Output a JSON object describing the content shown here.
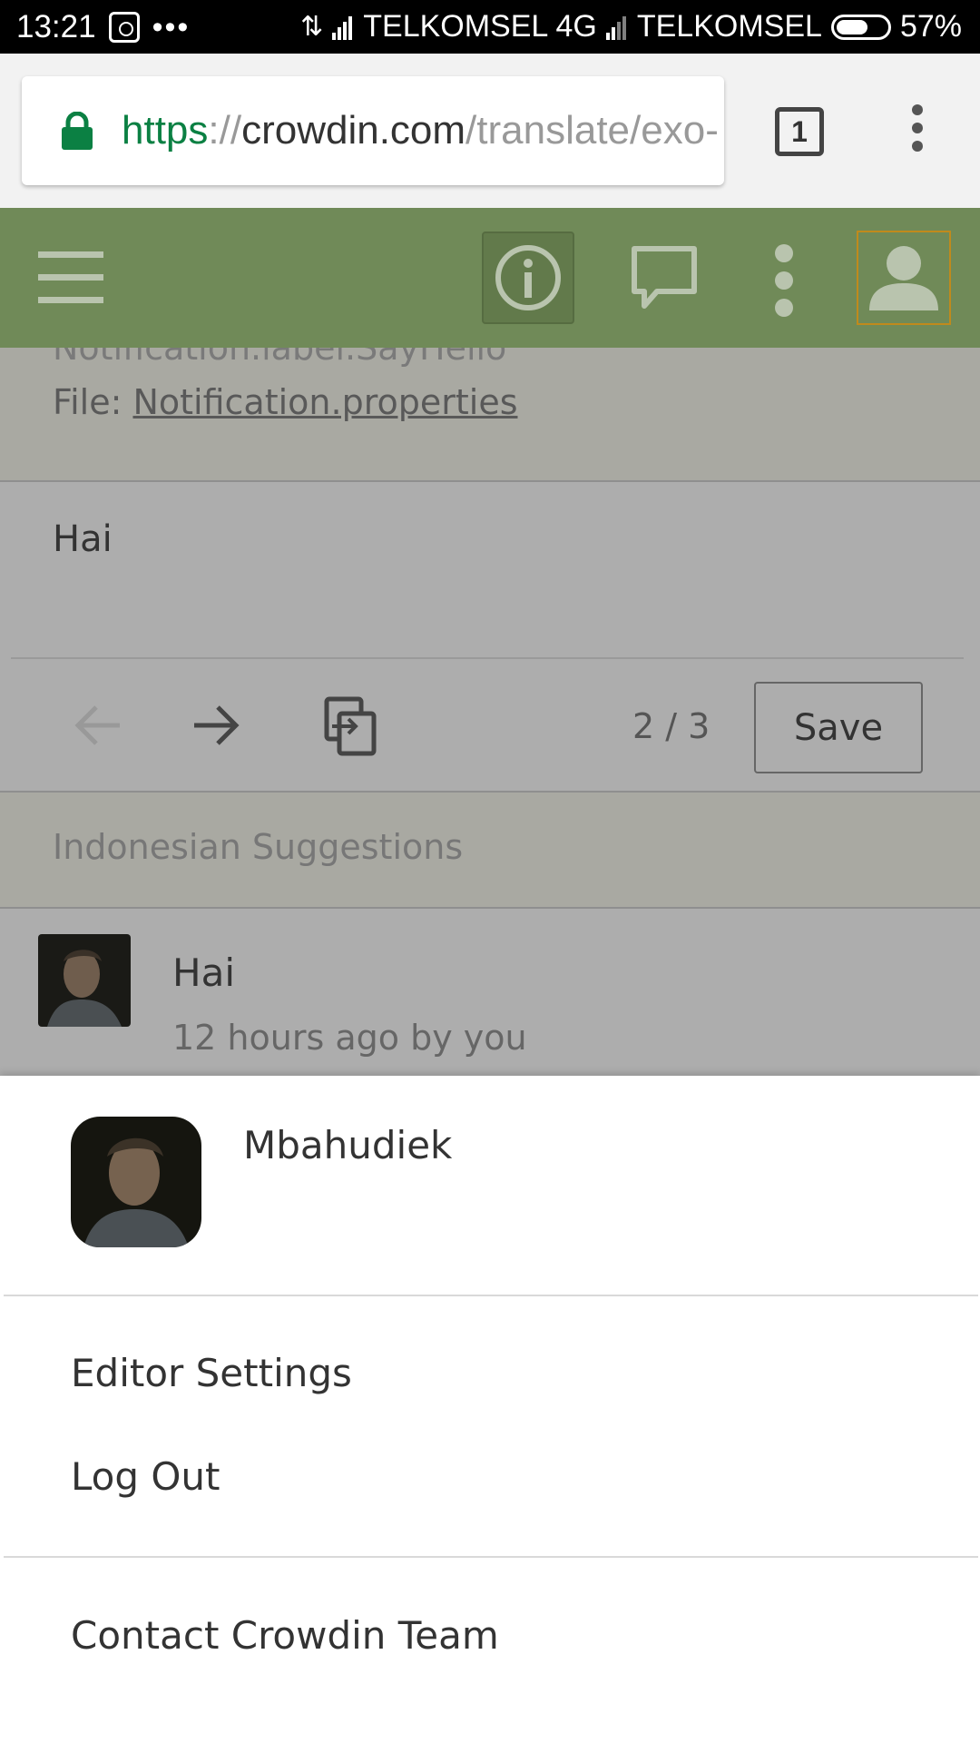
{
  "status_bar": {
    "time": "13:21",
    "carrier1": "TELKOMSEL 4G",
    "carrier2": "TELKOMSEL",
    "battery": "57%"
  },
  "browser": {
    "url_scheme": "https",
    "url_separator": "://",
    "url_host": "crowdin.com",
    "url_path": "/translate/exo-",
    "tab_count": "1"
  },
  "editor": {
    "key_text": "Notification.label.SayHello",
    "file_label": "File: ",
    "file_name": "Notification.properties",
    "translation": "Hai",
    "page_counter": "2 / 3",
    "save_label": "Save",
    "suggestions_title": "Indonesian Suggestions",
    "suggestion": {
      "text": "Hai",
      "meta": "12 hours ago by you"
    }
  },
  "menu": {
    "username": "Mbahudiek",
    "items": [
      "Editor Settings",
      "Log Out",
      "Contact Crowdin Team"
    ]
  },
  "colors": {
    "app_bar": "#708a58",
    "url_scheme": "#0b8043",
    "user_button_border": "#c08a1c"
  }
}
